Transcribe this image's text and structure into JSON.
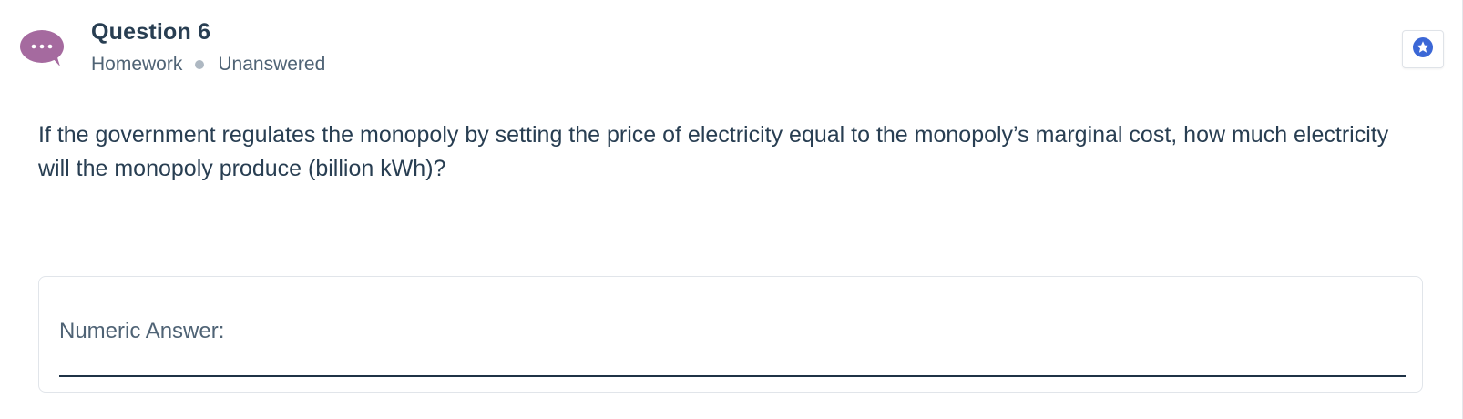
{
  "question": {
    "title": "Question 6",
    "category": "Homework",
    "status": "Unanswered",
    "prompt": "If the government regulates the monopoly by setting the price of electricity equal to the monopoly’s marginal cost, how much electricity will the monopoly produce (billion kWh)?"
  },
  "answer": {
    "label": "Numeric Answer:",
    "value": ""
  },
  "icons": {
    "question_type": "chat-bubble-icon",
    "bookmark": "star-badge-icon"
  },
  "colors": {
    "chat_icon": "#a56a9f",
    "bookmark_icon": "#3b67d6",
    "text": "#283e52",
    "muted": "#4f6375"
  }
}
